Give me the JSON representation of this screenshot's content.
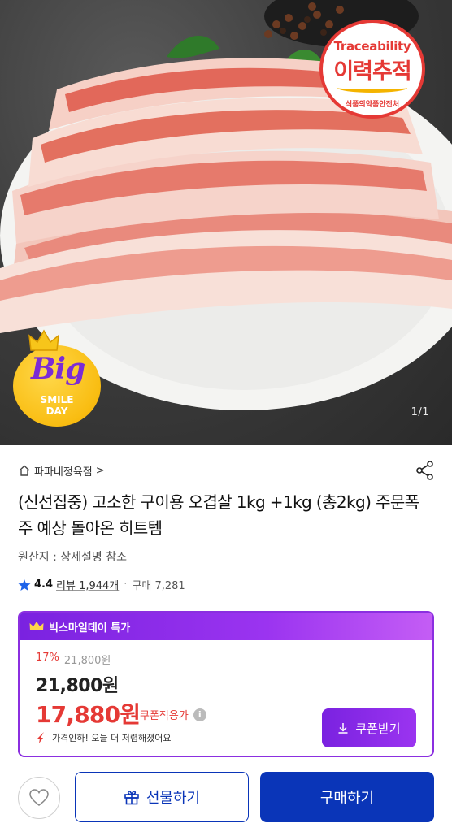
{
  "hero": {
    "image_counter": "1/1",
    "traceability_badge": {
      "english": "Traceability",
      "korean": "이력추적",
      "organization": "식품의약품안전처"
    },
    "promo_badge": {
      "big": "Big",
      "smile": "SMILE",
      "day": "DAY"
    }
  },
  "store": {
    "name": "파파네정육점",
    "chevron": ">"
  },
  "product": {
    "title": "(신선집중) 고소한 구이용 오겹살 1kg +1kg (총2kg) 주문폭주 예상 돌아온 히트템",
    "origin": "원산지 : 상세설명 참조",
    "rating": "4.4",
    "reviews_label": "리뷰 1,944개",
    "purchases_label": "구매 7,281"
  },
  "deal": {
    "header": "빅스마일데이 특가",
    "discount_rate": "17%",
    "original_price": "21,800원",
    "price": "21,800원",
    "coupon_price": "17,880원",
    "coupon_note": "쿠폰적용가",
    "drop_note": "가격인하! 오늘 더 저렴해졌어요",
    "coupon_button": "쿠폰받기"
  },
  "bottom_bar": {
    "gift_button": "선물하기",
    "buy_button": "구매하기"
  },
  "colors": {
    "brand_blue": "#0a35b8",
    "promo_purple": "#8b2fe0",
    "sale_red": "#e53935"
  },
  "icons": [
    "home-icon",
    "share-icon",
    "star-icon",
    "crown-icon",
    "info-icon",
    "arrow-down-icon",
    "download-icon",
    "heart-icon",
    "gift-icon"
  ]
}
